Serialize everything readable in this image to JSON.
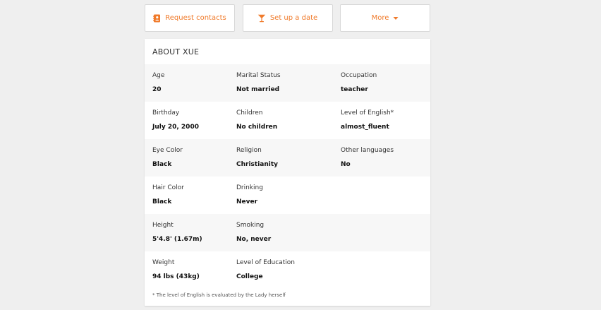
{
  "actions": {
    "request_contacts": "Request contacts",
    "set_up_date": "Set up a date",
    "more": "More"
  },
  "colors": {
    "accent": "#f07a2a",
    "background": "#efefef",
    "card": "#ffffff",
    "row_shade": "#f7f7f7"
  },
  "icons": {
    "request_contacts": "contact-book-icon",
    "set_up_date": "cocktail-glass-icon",
    "more": "caret-down-icon"
  },
  "about": {
    "title": "ABOUT XUE",
    "rows": [
      [
        {
          "label": "Age",
          "value": "20"
        },
        {
          "label": "Marital Status",
          "value": "Not married"
        },
        {
          "label": "Occupation",
          "value": "teacher"
        }
      ],
      [
        {
          "label": "Birthday",
          "value": "July 20, 2000"
        },
        {
          "label": "Children",
          "value": "No children"
        },
        {
          "label": "Level of English*",
          "value": "almost_fluent"
        }
      ],
      [
        {
          "label": "Eye Color",
          "value": "Black"
        },
        {
          "label": "Religion",
          "value": "Christianity"
        },
        {
          "label": "Other languages",
          "value": "No"
        }
      ],
      [
        {
          "label": "Hair Color",
          "value": "Black"
        },
        {
          "label": "Drinking",
          "value": "Never"
        }
      ],
      [
        {
          "label": "Height",
          "value": "5'4.8' (1.67m)"
        },
        {
          "label": "Smoking",
          "value": "No, never"
        }
      ],
      [
        {
          "label": "Weight",
          "value": "94 lbs (43kg)"
        },
        {
          "label": "Level of Education",
          "value": "College"
        }
      ]
    ],
    "footnote": "* The level of English is evaluated by the Lady herself"
  }
}
